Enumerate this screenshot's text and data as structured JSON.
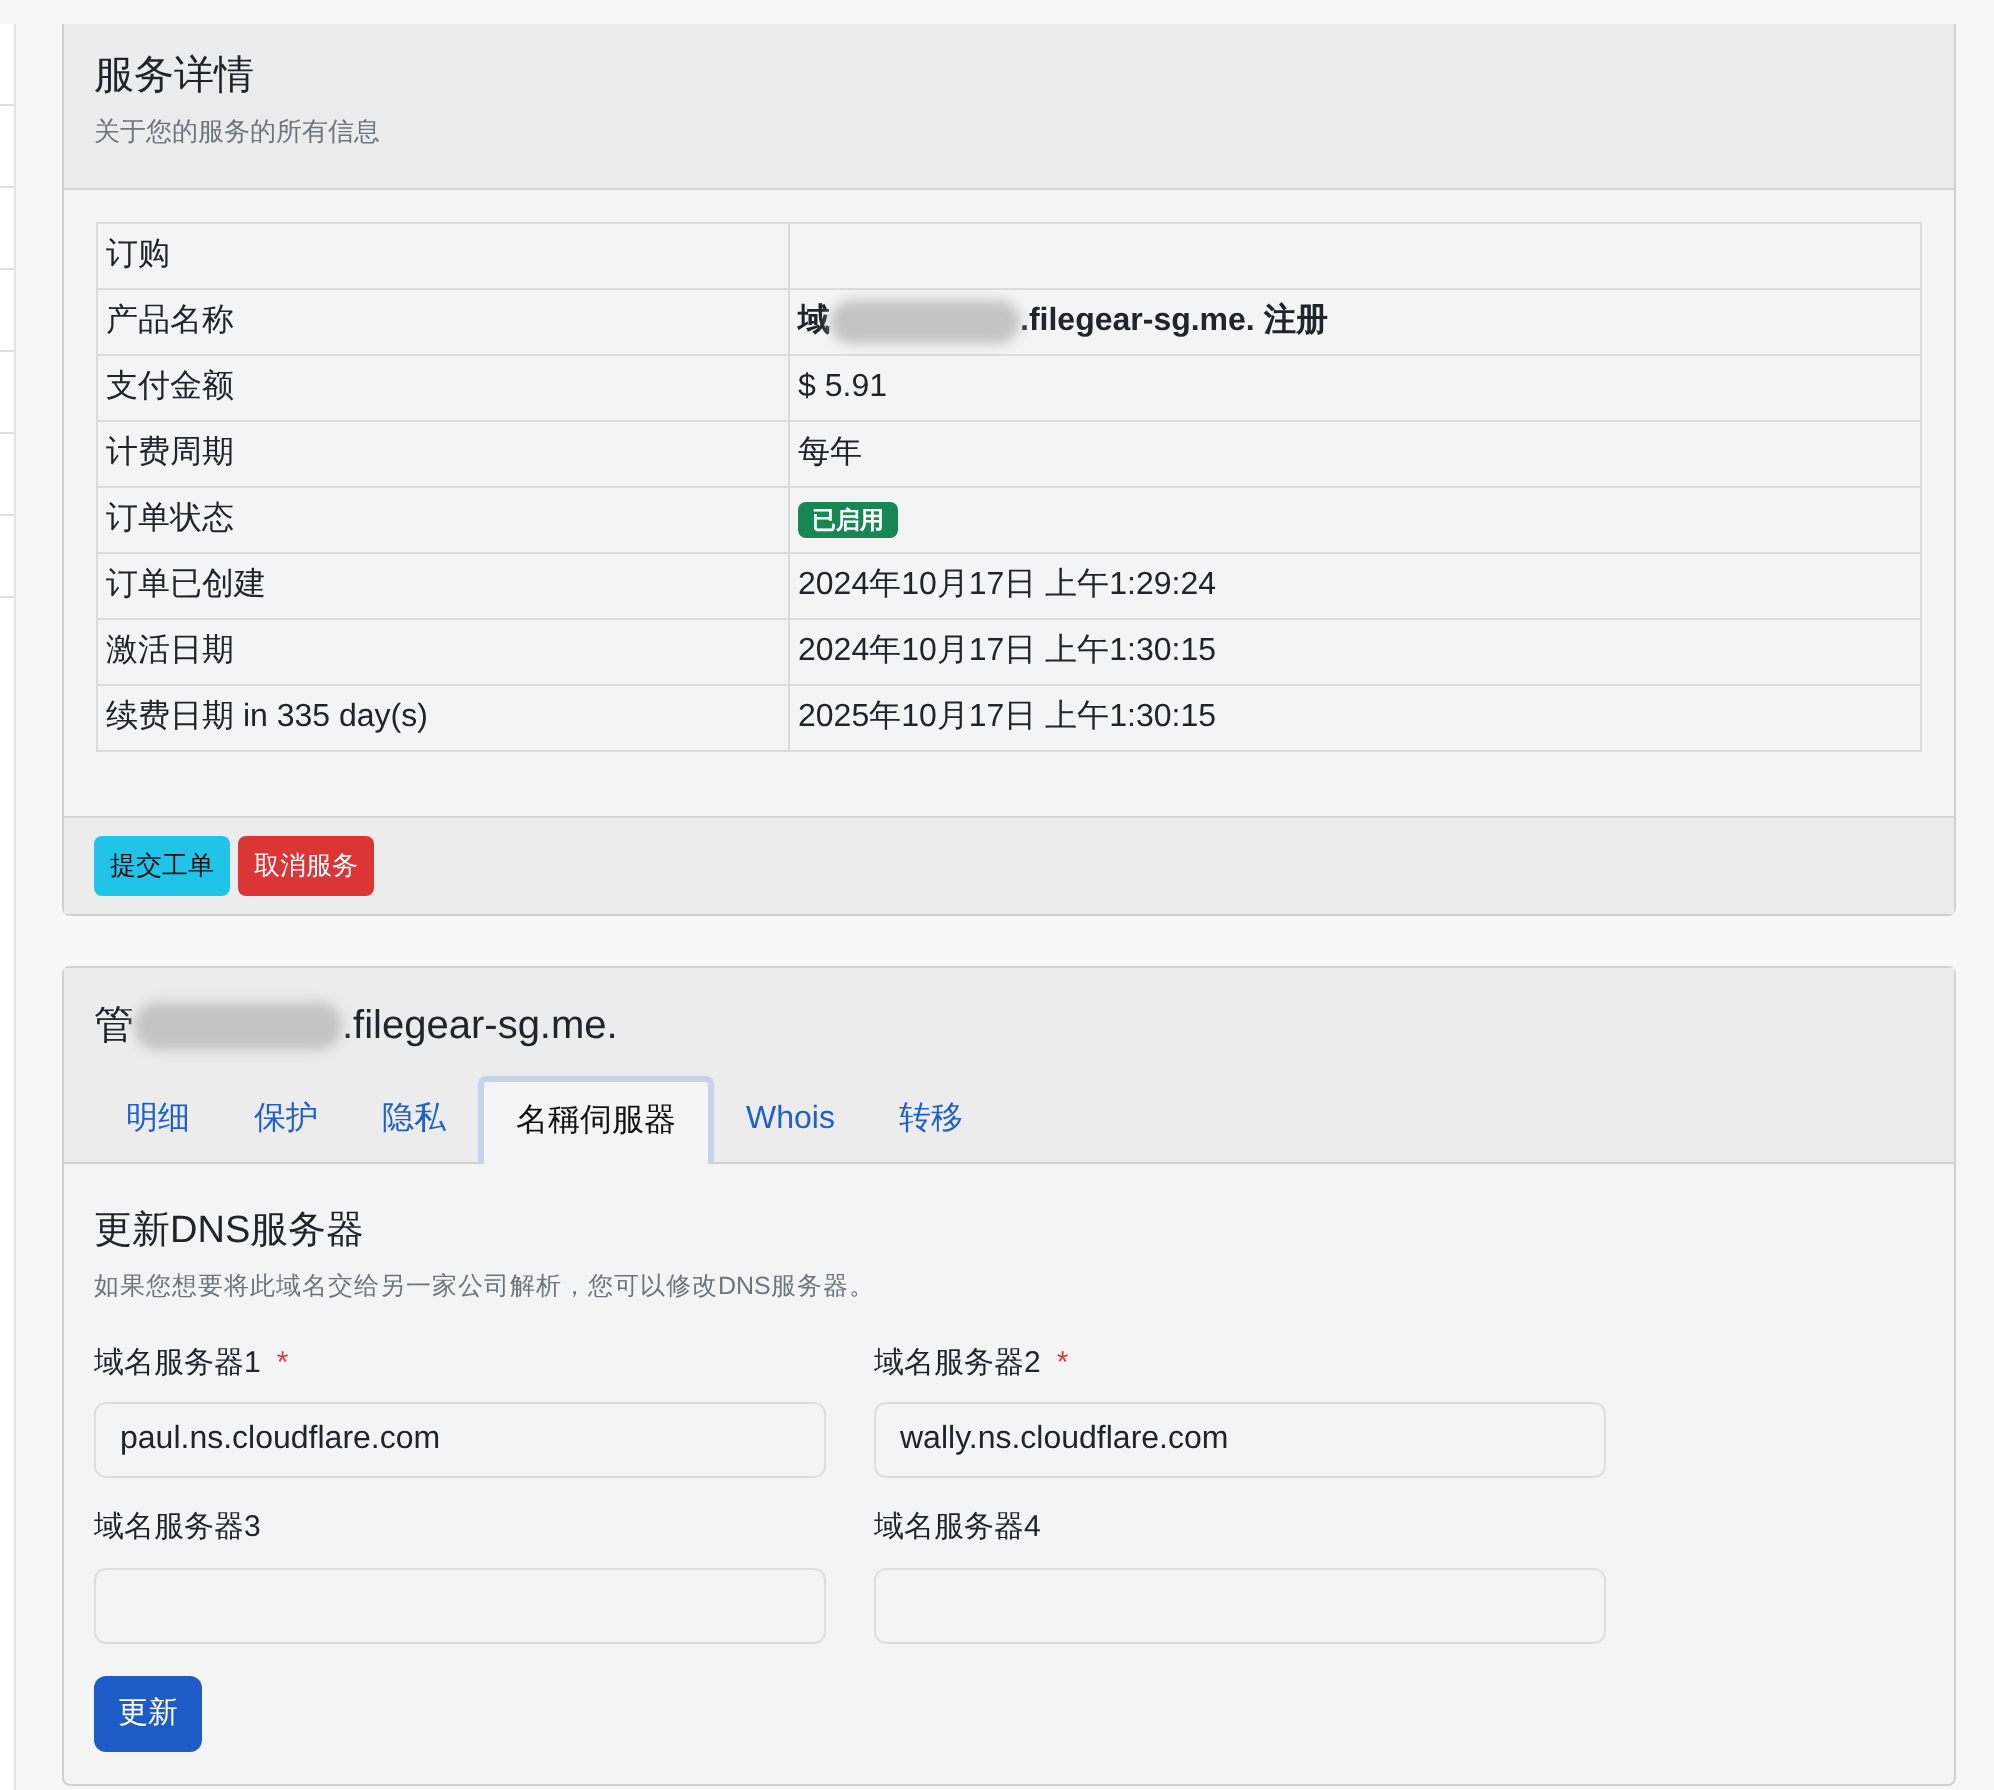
{
  "service_details": {
    "title": "服务详情",
    "subtitle": "关于您的服务的所有信息",
    "rows": [
      {
        "kind": "text",
        "label": "订购"
      },
      {
        "kind": "redacted",
        "label": "产品名称",
        "value_start": "域",
        "value_end": ".filegear-sg.me. 注册"
      },
      {
        "kind": "text",
        "label": "支付金额",
        "value": "$ 5.91"
      },
      {
        "kind": "text",
        "label": "计费周期",
        "value": "每年"
      },
      {
        "kind": "badge",
        "label": "订单状态",
        "value": "已启用",
        "color": "#198754"
      },
      {
        "kind": "text",
        "label": "订单已创建",
        "value": "2024年10月17日 上午1:29:24"
      },
      {
        "kind": "text",
        "label": "激活日期",
        "value": "2024年10月17日 上午1:30:15"
      },
      {
        "kind": "text",
        "label": "续费日期 in 335 day(s)",
        "value": "2025年10月17日 上午1:30:15"
      }
    ],
    "buttons": [
      {
        "label": "提交工单",
        "kind": "info"
      },
      {
        "label": "取消服务",
        "kind": "danger"
      }
    ]
  },
  "manage": {
    "title_start": "管",
    "title_end": ".filegear-sg.me.",
    "tabs": [
      {
        "label": "明细",
        "selected": false
      },
      {
        "label": "保护",
        "selected": false
      },
      {
        "label": "隐私",
        "selected": false
      },
      {
        "label": "名稱伺服器",
        "selected": true
      },
      {
        "label": "Whois",
        "selected": false
      },
      {
        "label": "转移",
        "selected": false
      }
    ],
    "heading": "更新DNS服务器",
    "description": "如果您想要将此域名交给另一家公司解析，您可以修改DNS服务器。",
    "fields": [
      {
        "label": "域名服务器1",
        "required": true,
        "value": "paul.ns.cloudflare.com"
      },
      {
        "label": "域名服务器2",
        "required": true,
        "value": "wally.ns.cloudflare.com"
      },
      {
        "label": "域名服务器3",
        "required": false
      },
      {
        "label": "域名服务器4",
        "required": false
      }
    ],
    "required_mark": "*",
    "submit": "更新"
  }
}
